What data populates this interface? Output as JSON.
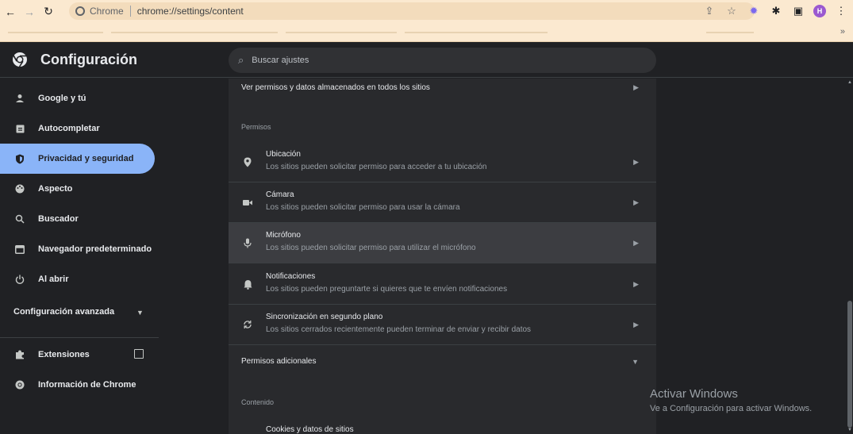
{
  "browser": {
    "chip": "Chrome",
    "url": "chrome://settings/content",
    "avatar_letter": "H",
    "bookmarks_more": "»"
  },
  "header": {
    "title": "Configuración",
    "search_placeholder": "Buscar ajustes"
  },
  "sidebar": {
    "items": [
      {
        "label": "Google y tú",
        "icon": "person-icon"
      },
      {
        "label": "Autocompletar",
        "icon": "clipboard-icon"
      },
      {
        "label": "Privacidad y seguridad",
        "icon": "shield-icon",
        "active": true
      },
      {
        "label": "Aspecto",
        "icon": "palette-icon"
      },
      {
        "label": "Buscador",
        "icon": "search-icon"
      },
      {
        "label": "Navegador predeterminado",
        "icon": "browser-icon"
      },
      {
        "label": "Al abrir",
        "icon": "power-icon"
      }
    ],
    "advanced": "Configuración avanzada",
    "extensions": "Extensiones",
    "about": "Información de Chrome"
  },
  "main": {
    "all_sites": "Ver permisos y datos almacenados en todos los sitios",
    "permissions_section": "Permisos",
    "permissions": [
      {
        "title": "Ubicación",
        "desc": "Los sitios pueden solicitar permiso para acceder a tu ubicación",
        "icon": "location-pin-icon"
      },
      {
        "title": "Cámara",
        "desc": "Los sitios pueden solicitar permiso para usar la cámara",
        "icon": "camera-icon"
      },
      {
        "title": "Micrófono",
        "desc": "Los sitios pueden solicitar permiso para utilizar el micrófono",
        "icon": "microphone-icon"
      },
      {
        "title": "Notificaciones",
        "desc": "Los sitios pueden preguntarte si quieres que te envíen notificaciones",
        "icon": "bell-icon"
      },
      {
        "title": "Sincronización en segundo plano",
        "desc": "Los sitios cerrados recientemente pueden terminar de enviar y recibir datos",
        "icon": "sync-icon"
      }
    ],
    "additional_permissions": "Permisos adicionales",
    "content_section": "Contenido",
    "cookies": "Cookies y datos de sitios"
  },
  "watermark": {
    "line1": "Activar Windows",
    "line2": "Ve a Configuración para activar Windows."
  },
  "colors": {
    "accent": "#8ab4f8",
    "background": "#202124",
    "card": "#292a2d",
    "toolbar": "#fbe9d0"
  }
}
